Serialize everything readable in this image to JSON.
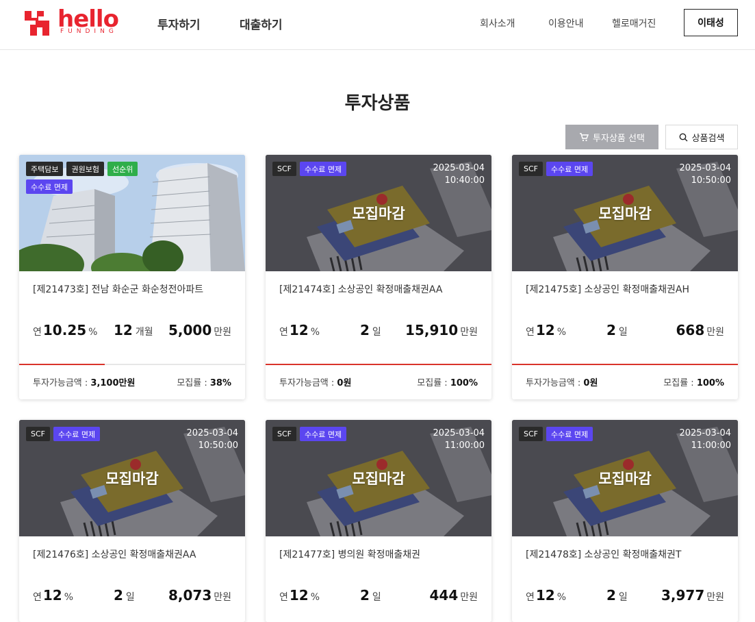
{
  "header": {
    "logo_text": "hello",
    "logo_sub": "FUNDING",
    "main_nav": [
      "투자하기",
      "대출하기"
    ],
    "sub_nav": [
      "회사소개",
      "이용안내",
      "헬로매거진"
    ],
    "user_label": "이태성"
  },
  "page": {
    "title": "투자상품",
    "select_label": "투자상품 선택",
    "search_label": "상품검색"
  },
  "labels": {
    "rate_prefix": "연",
    "percent": "%",
    "won_unit": "만원",
    "closed": "모집마감",
    "available": "투자가능금액 : ",
    "rate_label": "모집률 : "
  },
  "products": [
    {
      "title": "[제21473호] 전남 화순군 화순청전아파트",
      "tags": [
        {
          "text": "주택담보",
          "color": "dark"
        },
        {
          "text": "권원보험",
          "color": "dark"
        },
        {
          "text": "선순위",
          "color": "green"
        },
        {
          "text": "수수료 면제",
          "color": "purple"
        }
      ],
      "date": "",
      "time": "",
      "rate": "10.25",
      "period_value": "12",
      "period_unit": "개월",
      "amount": "5,000",
      "available": "3,100만원",
      "funded": "38%",
      "progress": 0.38,
      "closed": false,
      "image": "apartment"
    },
    {
      "title": "[제21474호] 소상공인 확정매출채권AA",
      "tags": [
        {
          "text": "SCF",
          "color": "dark"
        },
        {
          "text": "수수료 면제",
          "color": "purple"
        }
      ],
      "date": "2025-03-04",
      "time": "10:40:00",
      "rate": "12",
      "period_value": "2",
      "period_unit": "일",
      "amount": "15,910",
      "available": "0원",
      "funded": "100%",
      "progress": 1.0,
      "closed": true,
      "image": "card"
    },
    {
      "title": "[제21475호] 소상공인 확정매출채권AH",
      "tags": [
        {
          "text": "SCF",
          "color": "dark"
        },
        {
          "text": "수수료 면제",
          "color": "purple"
        }
      ],
      "date": "2025-03-04",
      "time": "10:50:00",
      "rate": "12",
      "period_value": "2",
      "period_unit": "일",
      "amount": "668",
      "available": "0원",
      "funded": "100%",
      "progress": 1.0,
      "closed": true,
      "image": "card"
    },
    {
      "title": "[제21476호] 소상공인 확정매출채권AA",
      "tags": [
        {
          "text": "SCF",
          "color": "dark"
        },
        {
          "text": "수수료 면제",
          "color": "purple"
        }
      ],
      "date": "2025-03-04",
      "time": "10:50:00",
      "rate": "12",
      "period_value": "2",
      "period_unit": "일",
      "amount": "8,073",
      "available": "",
      "funded": "",
      "progress": 1.0,
      "closed": true,
      "image": "card"
    },
    {
      "title": "[제21477호] 병의원 확정매출채권",
      "tags": [
        {
          "text": "SCF",
          "color": "dark"
        },
        {
          "text": "수수료 면제",
          "color": "purple"
        }
      ],
      "date": "2025-03-04",
      "time": "11:00:00",
      "rate": "12",
      "period_value": "2",
      "period_unit": "일",
      "amount": "444",
      "available": "",
      "funded": "",
      "progress": 1.0,
      "closed": true,
      "image": "card"
    },
    {
      "title": "[제21478호] 소상공인 확정매출채권T",
      "tags": [
        {
          "text": "SCF",
          "color": "dark"
        },
        {
          "text": "수수료 면제",
          "color": "purple"
        }
      ],
      "date": "2025-03-04",
      "time": "11:00:00",
      "rate": "12",
      "period_value": "2",
      "period_unit": "일",
      "amount": "3,977",
      "available": "",
      "funded": "",
      "progress": 1.0,
      "closed": true,
      "image": "card"
    }
  ],
  "colors": {
    "brand": "#e8242f",
    "progress": "#d9332a",
    "tag_purple": "#5b46f0",
    "tag_green": "#2fae4a",
    "tag_dark": "#2a2a2a"
  }
}
